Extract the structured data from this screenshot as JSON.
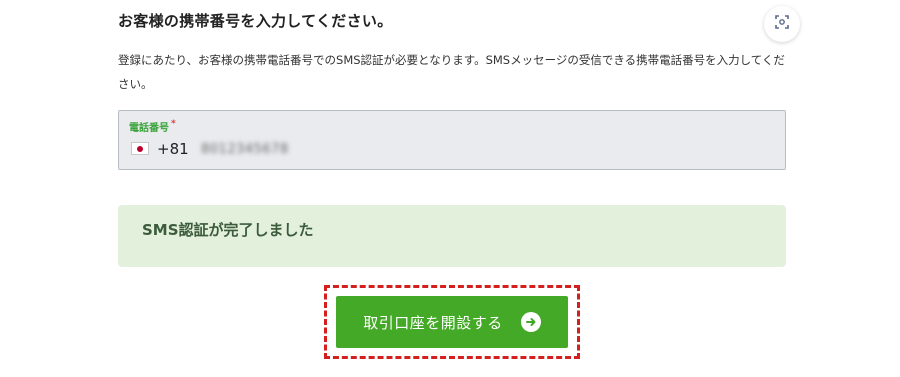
{
  "heading": "お客様の携帯番号を入力してください。",
  "description": "登録にあたり、お客様の携帯電話番号でのSMS認証が必要となります。SMSメッセージの受信できる携帯電話番号を入力してください。",
  "phone": {
    "label": "電話番号",
    "required_mark": "*",
    "country_code": "+81",
    "number": "8012345678"
  },
  "status": {
    "message": "SMS認証が完了しました"
  },
  "actions": {
    "open_account_label": "取引口座を開設する"
  },
  "icons": {
    "scan": "scan-icon",
    "flag": "japan-flag-icon",
    "arrow": "arrow-right-circle-icon"
  },
  "colors": {
    "primary_green": "#43a927",
    "success_bg": "#e3f1dc",
    "highlight_red": "#d41f1f",
    "label_green": "#3aa33a"
  }
}
